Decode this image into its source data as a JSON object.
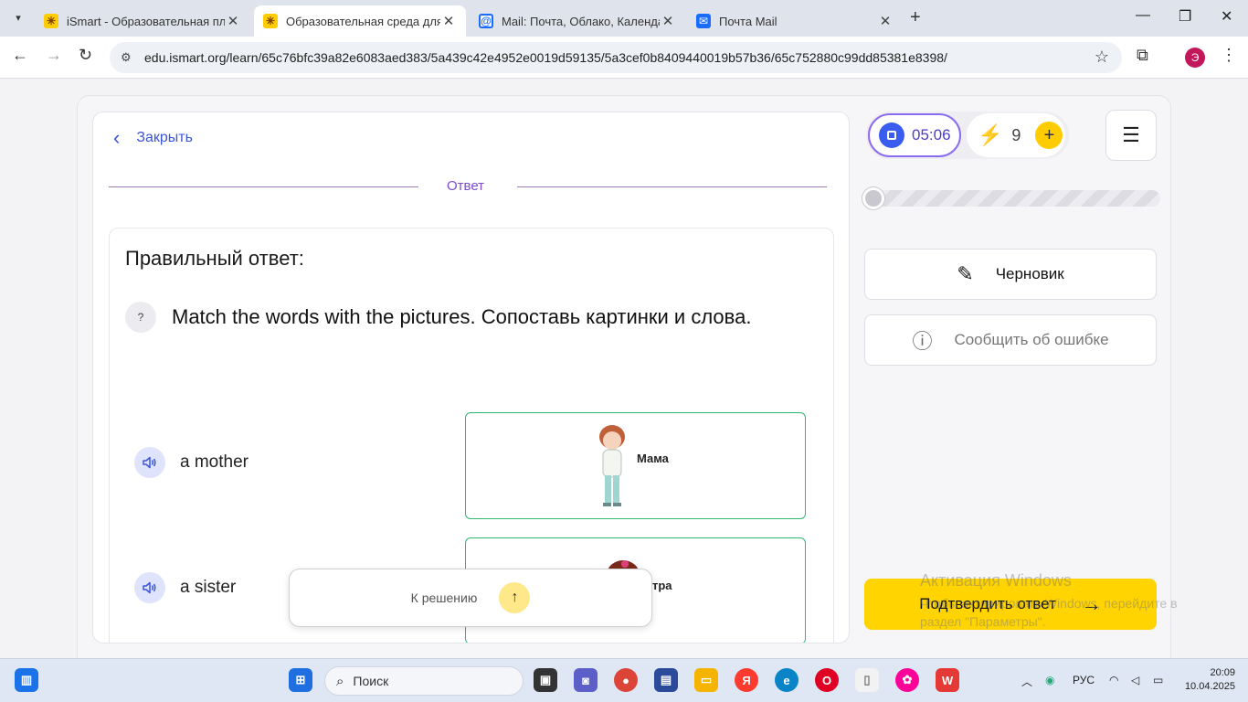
{
  "browser": {
    "tabs": [
      {
        "title": "iSmart - Образовательная пла",
        "icon": "ismart-icon",
        "active": false
      },
      {
        "title": "Образовательная среда для са",
        "icon": "ismart-icon",
        "active": true
      },
      {
        "title": "Mail: Почта, Облако, Календар",
        "icon": "mail-at-icon",
        "active": false
      },
      {
        "title": "Почта Mail",
        "icon": "mail-envelope-icon",
        "active": false
      }
    ],
    "url": "edu.ismart.org/learn/65c76bfc39a82e6083aed383/5a439c42e4952e0019d59135/5a3cef0b8409440019b57b36/65c752880c99dd85381e8398/",
    "profile_initial": "Э"
  },
  "lesson": {
    "close_label": "Закрыть",
    "section_label": "Ответ",
    "correct_title": "Правильный ответ:",
    "question_badge": "?",
    "question": "Match the words with the pictures. Сопоставь картинки и слова.",
    "pairs": [
      {
        "word": "a mother",
        "picture_label": "Мама"
      },
      {
        "word": "a sister",
        "picture_label": "тра"
      }
    ],
    "to_solution_label": "К решению"
  },
  "panel": {
    "timer": "05:06",
    "energy_count": "9",
    "draft_label": "Черновик",
    "report_label": "Сообщить об ошибке",
    "confirm_label": "Подтвердить ответ",
    "progress_fraction": 0.05
  },
  "watermark": {
    "title": "Активация Windows",
    "subtitle": "Чтобы активировать Windows, перейдите в раздел \"Параметры\"."
  },
  "taskbar": {
    "search_label": "Поиск",
    "language": "РУС",
    "time": "20:09",
    "date": "10.04.2025"
  },
  "colors": {
    "accent_blue": "#3a55d9",
    "accent_purple": "#7c4dcc",
    "confirm_yellow": "#ffd400",
    "match_green": "#2eb872"
  }
}
